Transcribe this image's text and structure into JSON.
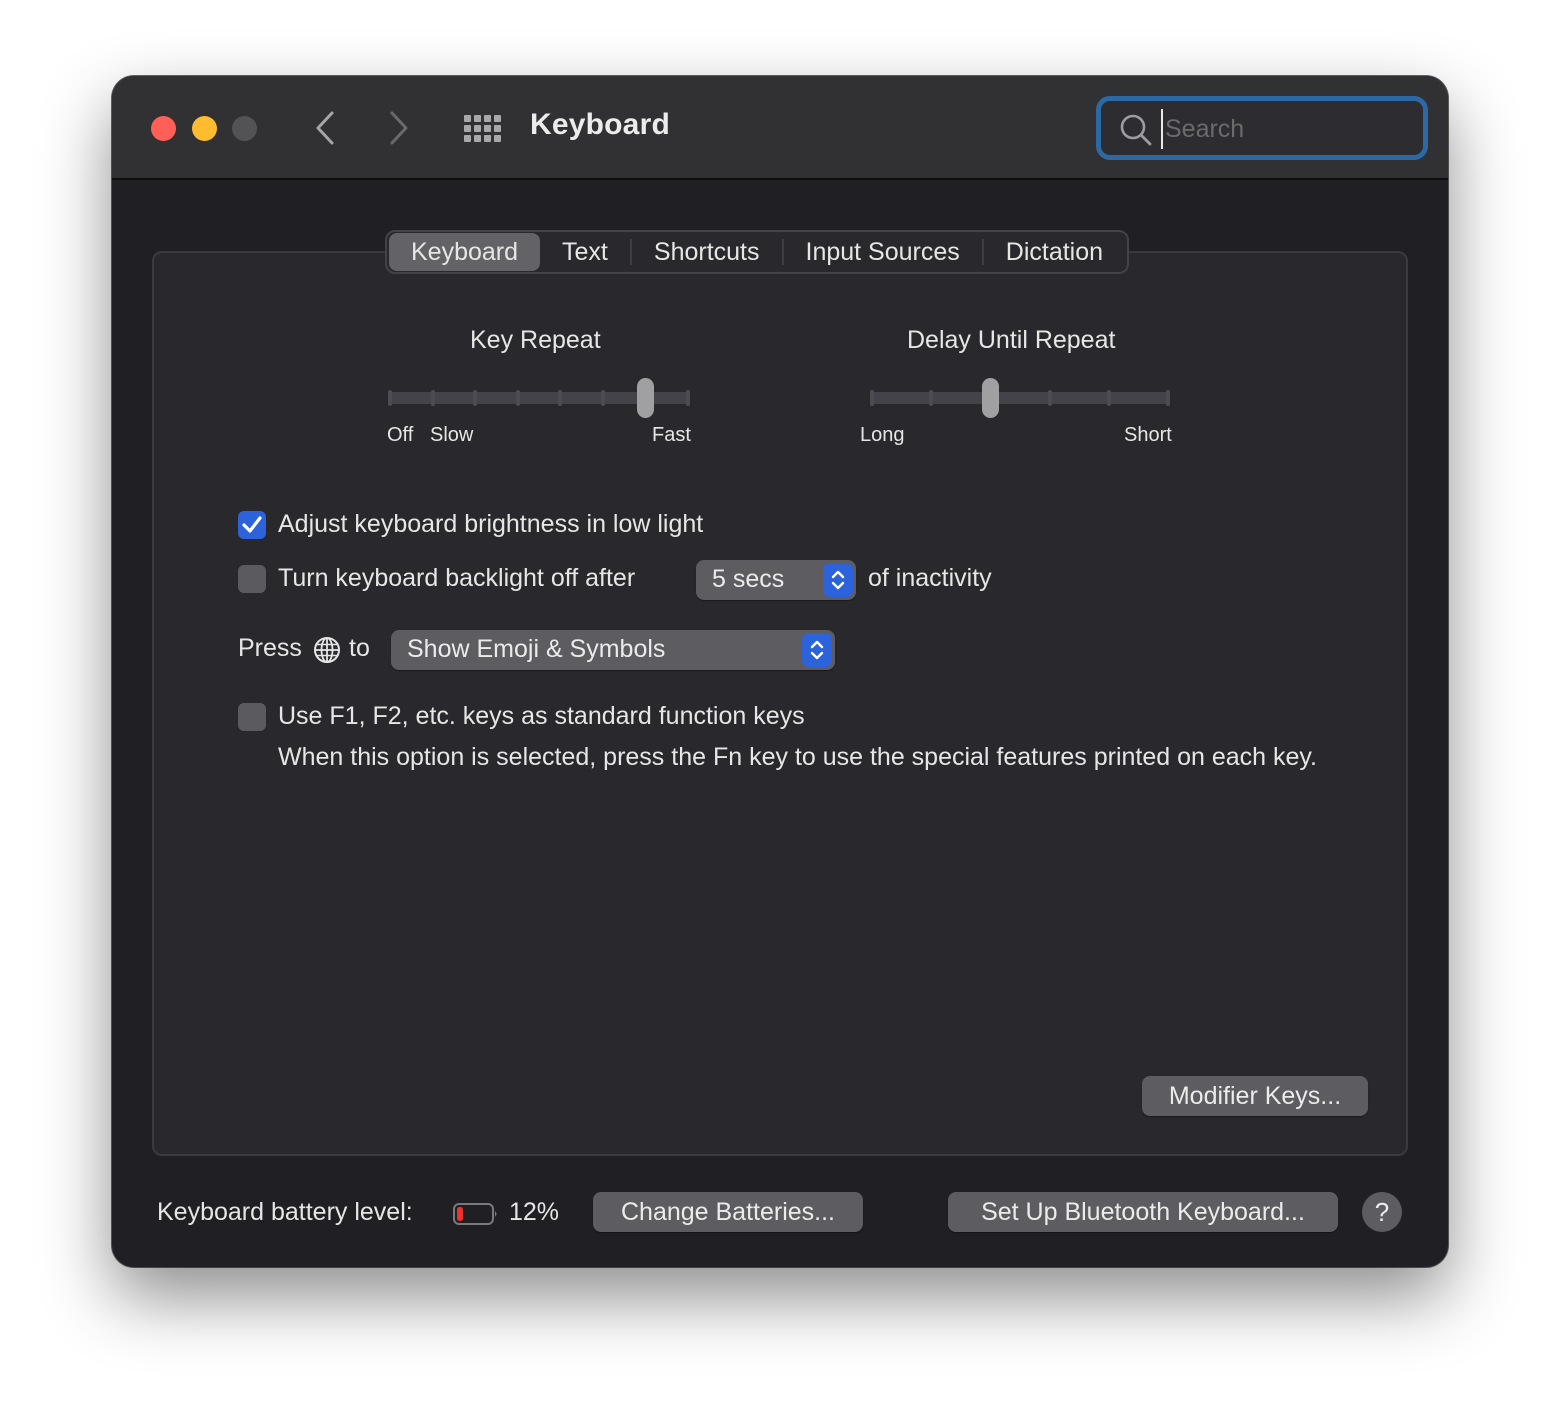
{
  "window": {
    "title": "Keyboard",
    "traffic_lights": {
      "close": "#fe5f57",
      "minimize": "#febc2e",
      "zoom": "#535255"
    },
    "nav": {
      "back_icon": "chevron-left-icon",
      "forward_icon": "chevron-right-icon",
      "grid_icon": "show-all-grid-icon"
    },
    "search": {
      "placeholder": "Search",
      "value": "",
      "focused": true,
      "accent": "#2d6aa5"
    }
  },
  "tabs": [
    {
      "label": "Keyboard",
      "active": true
    },
    {
      "label": "Text",
      "active": false
    },
    {
      "label": "Shortcuts",
      "active": false
    },
    {
      "label": "Input Sources",
      "active": false
    },
    {
      "label": "Dictation",
      "active": false
    }
  ],
  "key_repeat": {
    "title": "Key Repeat",
    "stops": 8,
    "value_index": 6,
    "labels": {
      "off": "Off",
      "slow": "Slow",
      "fast": "Fast"
    }
  },
  "delay_until_repeat": {
    "title": "Delay Until Repeat",
    "stops": 6,
    "value_index": 2,
    "labels": {
      "long": "Long",
      "short": "Short"
    }
  },
  "options": {
    "adjust_brightness": {
      "label": "Adjust keyboard brightness in low light",
      "checked": true
    },
    "backlight_off": {
      "label": "Turn keyboard backlight off after",
      "checked": false,
      "value": "5 secs",
      "suffix": "of inactivity"
    },
    "press_globe": {
      "prefix": "Press",
      "icon": "globe-icon",
      "to": "to",
      "value": "Show Emoji & Symbols"
    },
    "function_keys": {
      "label": "Use F1, F2, etc. keys as standard function keys",
      "checked": false,
      "description": "When this option is selected, press the Fn key to use the special features printed on each key."
    }
  },
  "buttons": {
    "modifier_keys": "Modifier Keys...",
    "change_batteries": "Change Batteries...",
    "setup_bluetooth": "Set Up Bluetooth Keyboard...",
    "help": "?"
  },
  "battery": {
    "label": "Keyboard battery level:",
    "percent": 12,
    "percent_text": "12%",
    "color": "#f2312d"
  },
  "colors": {
    "accent": "#2c63db",
    "window_bg": "#201f24",
    "panel_bg": "#29282d"
  }
}
